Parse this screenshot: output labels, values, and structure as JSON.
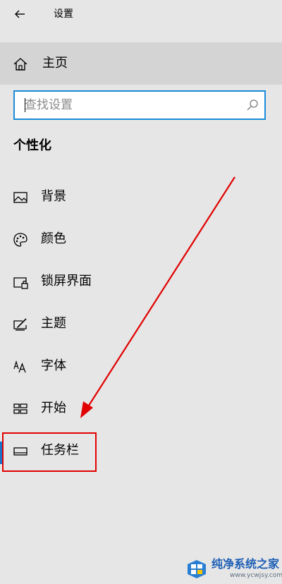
{
  "window": {
    "title": "设置"
  },
  "home": {
    "label": "主页",
    "icon": "home-icon"
  },
  "search": {
    "placeholder": "查找设置",
    "value": ""
  },
  "section": {
    "title": "个性化"
  },
  "nav_items": [
    {
      "label": "背景",
      "icon": "picture-icon"
    },
    {
      "label": "颜色",
      "icon": "palette-icon"
    },
    {
      "label": "锁屏界面",
      "icon": "lockscreen-icon"
    },
    {
      "label": "主题",
      "icon": "theme-brush-icon"
    },
    {
      "label": "字体",
      "icon": "font-icon"
    },
    {
      "label": "开始",
      "icon": "start-tiles-icon"
    },
    {
      "label": "任务栏",
      "icon": "taskbar-icon",
      "selected": true
    }
  ],
  "annotation": {
    "highlight_color": "#e10000",
    "highlighted_item": "任务栏"
  },
  "watermark": {
    "title": "纯净系统之家",
    "url": "www.ycwjsy.com"
  },
  "colors": {
    "accent": "#1a8bd8",
    "background": "#e6e6e6",
    "home_row": "#d4d4d4"
  }
}
